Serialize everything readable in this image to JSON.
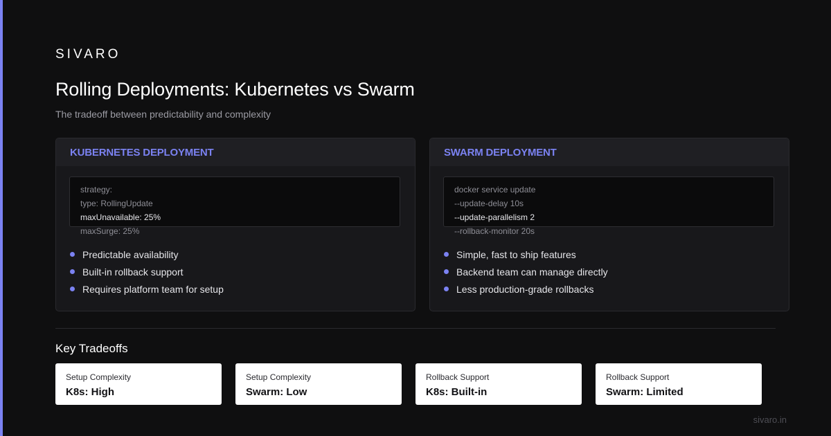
{
  "brand": "SIVARO",
  "title": "Rolling Deployments: Kubernetes vs Swarm",
  "subtitle": "The tradeoff between predictability and complexity",
  "colors": {
    "background": "#0f0f10",
    "accent": "#7b82f2",
    "panel": "#18181b",
    "card": "#ffffff"
  },
  "panels": [
    {
      "header": "KUBERNETES DEPLOYMENT",
      "code": [
        "strategy:",
        "type: RollingUpdate",
        "maxUnavailable: 25%",
        "maxSurge: 25%"
      ],
      "bullets": [
        "Predictable availability",
        "Built-in rollback support",
        "Requires platform team for setup"
      ]
    },
    {
      "header": "SWARM DEPLOYMENT",
      "code": [
        "docker service update",
        "--update-delay 10s",
        "--update-parallelism 2",
        "--rollback-monitor 20s"
      ],
      "bullets": [
        "Simple, fast to ship features",
        "Backend team can manage directly",
        "Less production-grade rollbacks"
      ]
    }
  ],
  "tradeoffs": {
    "title": "Key Tradeoffs",
    "cards": [
      {
        "label": "Setup Complexity",
        "value": "K8s: High"
      },
      {
        "label": "Setup Complexity",
        "value": "Swarm: Low"
      },
      {
        "label": "Rollback Support",
        "value": "K8s: Built-in"
      },
      {
        "label": "Rollback Support",
        "value": "Swarm: Limited"
      }
    ]
  },
  "footer": "sivaro.in"
}
